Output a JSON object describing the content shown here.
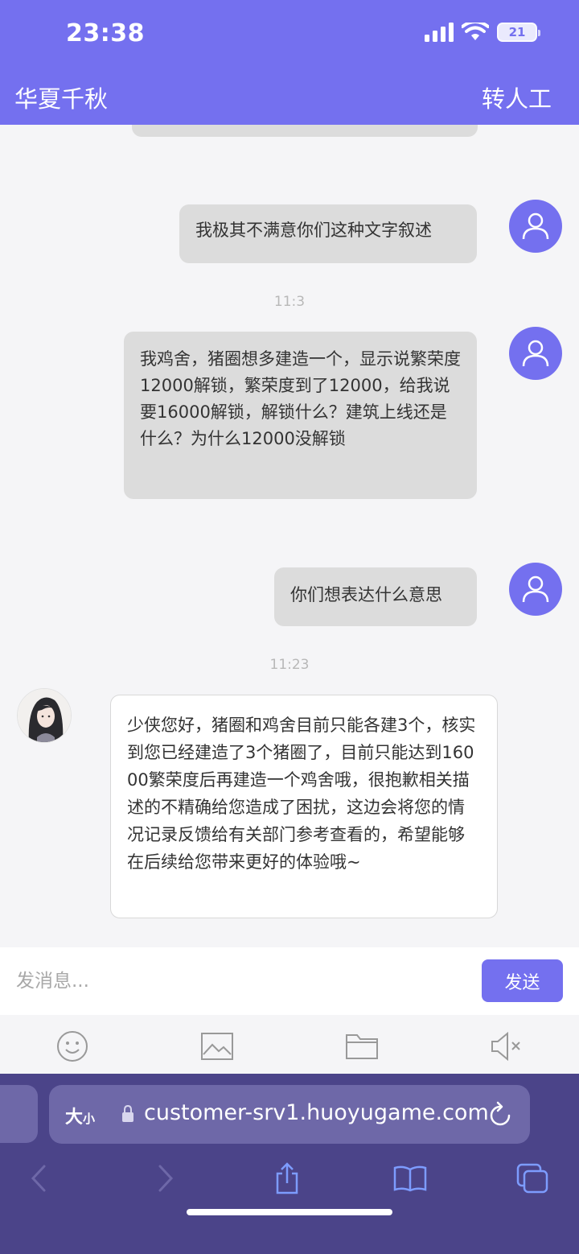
{
  "status_bar": {
    "time": "23:38",
    "battery": "21"
  },
  "header": {
    "title": "华夏千秋",
    "transfer_label": "转人工"
  },
  "chat": {
    "messages": [
      {
        "text": "我极其不满意你们这种文字叙述"
      },
      {
        "text": "我鸡舍，猪圈想多建造一个，显示说繁荣度12000解锁，繁荣度到了12000，给我说要16000解锁，解锁什么？建筑上线还是什么？为什么12000没解锁"
      },
      {
        "text": "你们想表达什么意思"
      },
      {
        "text": "少侠您好，猪圈和鸡舍目前只能各建3个，核实到您已经建造了3个猪圈了，目前只能达到16000繁荣度后再建造一个鸡舍哦，很抱歉相关描述的不精确给您造成了困扰，这边会将您的情况记录反馈给有关部门参考查看的，希望能够在后续给您带来更好的体验哦~"
      }
    ],
    "timestamps": [
      "11:3",
      "11:23"
    ]
  },
  "input": {
    "placeholder": "发消息...",
    "send_label": "发送"
  },
  "toolbar": {
    "icons": [
      "emoji-icon",
      "image-icon",
      "folder-icon",
      "mute-icon"
    ]
  },
  "browser": {
    "aa_label": "大",
    "aa_small": "小",
    "url": "customer-srv1.huoyugame.com"
  },
  "colors": {
    "accent": "#7470ef",
    "browser_bg": "#4b4489",
    "bubble_user": "#dcdcdc"
  }
}
